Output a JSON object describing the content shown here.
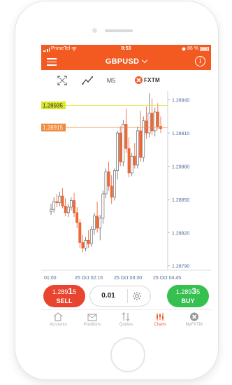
{
  "status_bar": {
    "carrier": "PrimeTel",
    "time": "8:53",
    "battery": "86 %"
  },
  "header": {
    "symbol": "GBPUSD"
  },
  "toolbar": {
    "timeframe": "M5",
    "brand": "FXTM"
  },
  "chart_data": {
    "type": "candlestick",
    "ylim": [
      1.28786,
      1.28948
    ],
    "y_ticks": [
      "1.28940",
      "1.28910",
      "1.28880",
      "1.28850",
      "1.28820",
      "1.28790"
    ],
    "x_ticks": [
      "01:00",
      "25 Oct 02:15",
      "25 Oct 03:30",
      "25 Oct 04:45"
    ],
    "price_lines": [
      {
        "label": "1.28935",
        "value": 1.28935,
        "color": "#d9e829"
      },
      {
        "label": "1.28915",
        "value": 1.28915,
        "color": "#f08a3c"
      }
    ],
    "candles": [
      [
        1.28839,
        1.28846,
        1.28836,
        1.28841
      ],
      [
        1.28841,
        1.28852,
        1.28838,
        1.28848
      ],
      [
        1.28848,
        1.28855,
        1.28843,
        1.28847
      ],
      [
        1.28847,
        1.28857,
        1.28844,
        1.28853
      ],
      [
        1.28853,
        1.2886,
        1.28842,
        1.28844
      ],
      [
        1.28844,
        1.28851,
        1.28835,
        1.28838
      ],
      [
        1.28838,
        1.28846,
        1.28834,
        1.28843
      ],
      [
        1.28843,
        1.28852,
        1.2884,
        1.28849
      ],
      [
        1.28849,
        1.28856,
        1.28834,
        1.28838
      ],
      [
        1.28838,
        1.28843,
        1.28824,
        1.28829
      ],
      [
        1.28829,
        1.28832,
        1.28806,
        1.28811
      ],
      [
        1.28811,
        1.28818,
        1.28802,
        1.28806
      ],
      [
        1.28806,
        1.28816,
        1.28803,
        1.28813
      ],
      [
        1.28813,
        1.28822,
        1.28806,
        1.2881
      ],
      [
        1.2881,
        1.28826,
        1.28807,
        1.28823
      ],
      [
        1.28823,
        1.28838,
        1.28818,
        1.28835
      ],
      [
        1.28835,
        1.28848,
        1.2882,
        1.28824
      ],
      [
        1.28824,
        1.28836,
        1.28813,
        1.28833
      ],
      [
        1.28833,
        1.28858,
        1.28828,
        1.28855
      ],
      [
        1.28855,
        1.28878,
        1.28851,
        1.28875
      ],
      [
        1.28875,
        1.28884,
        1.28858,
        1.28862
      ],
      [
        1.28862,
        1.28872,
        1.28846,
        1.28852
      ],
      [
        1.28852,
        1.28878,
        1.28849,
        1.28876
      ],
      [
        1.28876,
        1.28912,
        1.28868,
        1.2891
      ],
      [
        1.2891,
        1.28916,
        1.2888,
        1.28884
      ],
      [
        1.28884,
        1.28922,
        1.2888,
        1.28918
      ],
      [
        1.28918,
        1.28932,
        1.28892,
        1.28896
      ],
      [
        1.28896,
        1.28906,
        1.2887,
        1.28874
      ],
      [
        1.28874,
        1.28892,
        1.28871,
        1.28889
      ],
      [
        1.28889,
        1.28901,
        1.28878,
        1.28881
      ],
      [
        1.28881,
        1.28916,
        1.28878,
        1.28912
      ],
      [
        1.28912,
        1.2893,
        1.28884,
        1.28888
      ],
      [
        1.28888,
        1.28925,
        1.28884,
        1.28921
      ],
      [
        1.28921,
        1.28934,
        1.28905,
        1.2891
      ],
      [
        1.2891,
        1.28946,
        1.28906,
        1.28928
      ],
      [
        1.28928,
        1.28941,
        1.28908,
        1.28912
      ],
      [
        1.28912,
        1.28933,
        1.28907,
        1.28929
      ],
      [
        1.28929,
        1.28937,
        1.28913,
        1.28916
      ],
      [
        1.28916,
        1.28925,
        1.2891,
        1.28914
      ]
    ]
  },
  "trade": {
    "sell": {
      "price_main": "1.289",
      "price_big": "1",
      "price_sup": "5",
      "label": "SELL"
    },
    "amount": "0.01",
    "buy": {
      "price_main": "1.289",
      "price_big": "3",
      "price_sup": "5",
      "label": "BUY"
    }
  },
  "nav": [
    {
      "label": "Accounts",
      "icon": "home-icon"
    },
    {
      "label": "Positions",
      "icon": "briefcase-icon"
    },
    {
      "label": "Quotes",
      "icon": "updown-arrows-icon"
    },
    {
      "label": "Charts",
      "icon": "candlestick-icon",
      "active": true
    },
    {
      "label": "MyFXTM",
      "icon": "fxtm-logo-icon"
    }
  ]
}
